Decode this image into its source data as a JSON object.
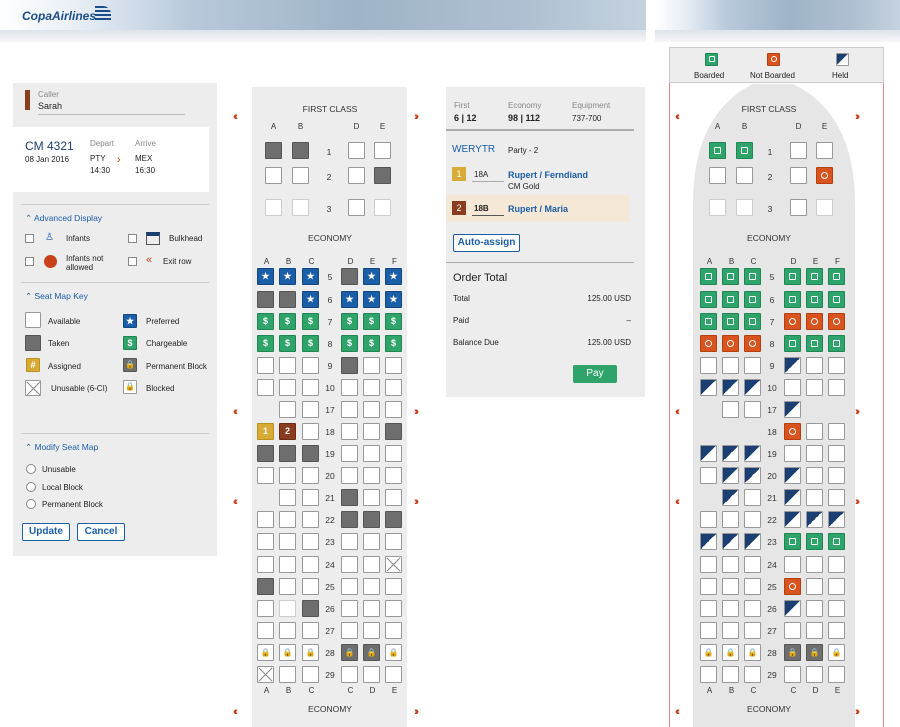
{
  "brand": {
    "name": "CopaAirlines"
  },
  "caller": {
    "label": "Caller",
    "name": "Sarah"
  },
  "flight": {
    "number": "CM 4321",
    "date": "08 Jan 2016",
    "depart_label": "Depart",
    "depart_code": "PTY",
    "depart_time": "14:30",
    "arrive_label": "Arrive",
    "arrive_code": "MEX",
    "arrive_time": "16:30"
  },
  "advanced": {
    "title": "Advanced Display",
    "infants": "Infants",
    "bulkhead": "Bulkhead",
    "infants_not": "Infants not allowed",
    "exit_row": "Exit row"
  },
  "key": {
    "title": "Seat Map Key",
    "available": "Available",
    "preferred": "Preferred",
    "taken": "Taken",
    "chargeable": "Chargeable",
    "assigned": "Assigned",
    "perm_block": "Permanent Block",
    "unusable": "Unusable (6-CI)",
    "blocked": "Blocked",
    "assigned_symbol": "#",
    "chargeable_symbol": "$"
  },
  "modify": {
    "title": "Modify Seat Map",
    "opt1": "Unusable",
    "opt2": "Local Block",
    "opt3": "Permanent Block",
    "update": "Update",
    "cancel": "Cancel"
  },
  "seatmap": {
    "first_class": "FIRST CLASS",
    "economy": "ECONOMY",
    "first_cols": [
      "A",
      "B",
      "D",
      "E"
    ],
    "econ_cols": [
      "A",
      "B",
      "C",
      "D",
      "E",
      "F"
    ],
    "last_cols": [
      "A",
      "B",
      "C",
      "C",
      "D",
      "E"
    ],
    "rows": [
      "1",
      "2",
      "3",
      "5",
      "6",
      "7",
      "8",
      "9",
      "10",
      "17",
      "18",
      "19",
      "20",
      "21",
      "22",
      "23",
      "24",
      "25",
      "26",
      "27",
      "28",
      "29"
    ],
    "assigned_labels": [
      "1",
      "2"
    ]
  },
  "summary": {
    "first_label": "First",
    "first_val": "6 | 12",
    "econ_label": "Economy",
    "econ_val": "98 | 112",
    "equip_label": "Equipment",
    "equip_val": "737-700",
    "pnr": "WERYTR",
    "party": "Party - 2",
    "p1_num": "1",
    "p1_seat": "18A",
    "p1_name": "Rupert / Ferndiand",
    "p1_tier": "CM Gold",
    "p2_num": "2",
    "p2_seat": "18B",
    "p2_name": "Rupert / Maria",
    "auto": "Auto-assign",
    "order_title": "Order Total",
    "total_label": "Total",
    "total_val": "125.00 USD",
    "paid_label": "Paid",
    "paid_val": "–",
    "due_label": "Balance Due",
    "due_val": "125.00 USD",
    "pay": "Pay"
  },
  "legend": {
    "boarded": "Boarded",
    "not_boarded": "Not Boarded",
    "held": "Held"
  },
  "colors": {
    "brand_blue": "#1a5ea8",
    "green": "#2ea36a",
    "orange": "#d9531e",
    "navy": "#1c3f73",
    "exit_red": "#c8401c"
  }
}
